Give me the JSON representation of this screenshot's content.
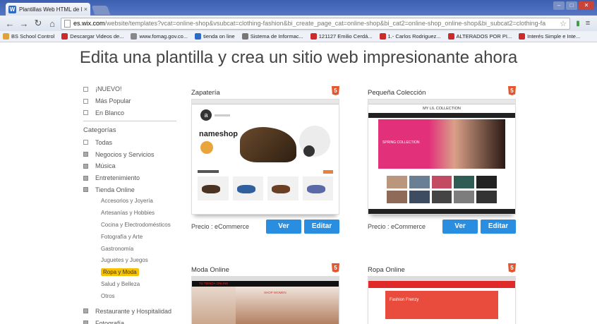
{
  "browser": {
    "tab_title": "Plantillas Web HTML de M",
    "tab_close": "×",
    "url_host": "es.wix.com",
    "url_path": "/website/templates?vcat=online-shop&vsubcat=clothing-fashion&bi_create_page_cat=online-shop&bi_cat2=online-shop_online-shop&bi_subcat2=clothing-fa",
    "bookmarks": [
      {
        "label": "BS School Control",
        "icon": "bookmark-icon",
        "color": "#e0a23a"
      },
      {
        "label": "Descargar Videos de...",
        "icon": "youtube-icon",
        "color": "#cc2b2b"
      },
      {
        "label": "www.fomag.gov.co...",
        "icon": "page-icon",
        "color": "#888888"
      },
      {
        "label": "tienda on line",
        "icon": "wix-icon",
        "color": "#2c6bc6"
      },
      {
        "label": "Sistema de Informac...",
        "icon": "page-icon",
        "color": "#777777"
      },
      {
        "label": "121127 Emilio Cerdá...",
        "icon": "youtube-icon",
        "color": "#cc2b2b"
      },
      {
        "label": "1.- Carlos Rodriguez...",
        "icon": "youtube-icon",
        "color": "#cc2b2b"
      },
      {
        "label": "ALTERADOS POR PI...",
        "icon": "youtube-icon",
        "color": "#cc2b2b"
      },
      {
        "label": "Interés Simple e Inte...",
        "icon": "youtube-icon",
        "color": "#cc2b2b"
      }
    ]
  },
  "headline": "Edita una plantilla y crea un sitio web impresionante ahora",
  "sidebar": {
    "top_items": [
      "¡NUEVO!",
      "Más Popular",
      "En Blanco"
    ],
    "categories_heading": "Categorías",
    "categories": [
      {
        "label": "Todas",
        "filled": false
      },
      {
        "label": "Negocios y Servicios",
        "filled": true
      },
      {
        "label": "Música",
        "filled": true
      },
      {
        "label": "Entretenimiento",
        "filled": true
      },
      {
        "label": "Tienda Online",
        "filled": true
      }
    ],
    "subcategories": [
      "Accesorios y Joyería",
      "Artesanías y Hobbies",
      "Cocina y Electrodomésticos",
      "Fotografía y Arte",
      "Gastronomía",
      "Juguetes y Juegos",
      "Ropa y Moda",
      "Salud y Belleza",
      "Otros"
    ],
    "active_subcategory": "Ropa y Moda",
    "more_categories": [
      "Restaurante y Hospitalidad",
      "Fotografía"
    ]
  },
  "templates": [
    {
      "title": "Zapatería",
      "price": "Precio : eCommerce",
      "view_label": "Ver",
      "edit_label": "Editar",
      "thumb_brand": "nameshop"
    },
    {
      "title": "Pequeña Colección",
      "price": "Precio : eCommerce",
      "view_label": "Ver",
      "edit_label": "Editar",
      "thumb_brand": "MY LIL COLLECTION",
      "thumb_banner": "SPRING COLLECTION"
    },
    {
      "title": "Moda Online",
      "thumb_brand": "TU TIENDA ONLINE",
      "thumb_banner": "SHOP WOMEN"
    },
    {
      "title": "Ropa Online",
      "thumb_banner": "Fashion Frenzy"
    }
  ],
  "colors": {
    "accent_button": "#2a8ee0",
    "active_highlight": "#f7c300",
    "html5_badge": "#e4572e"
  }
}
